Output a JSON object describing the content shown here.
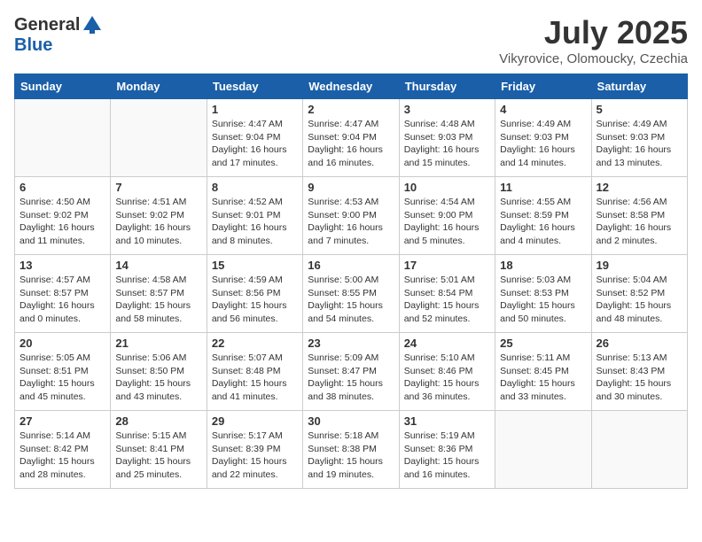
{
  "header": {
    "logo_general": "General",
    "logo_blue": "Blue",
    "month_title": "July 2025",
    "subtitle": "Vikyrovice, Olomoucky, Czechia"
  },
  "days_of_week": [
    "Sunday",
    "Monday",
    "Tuesday",
    "Wednesday",
    "Thursday",
    "Friday",
    "Saturday"
  ],
  "weeks": [
    [
      {
        "day": "",
        "content": ""
      },
      {
        "day": "",
        "content": ""
      },
      {
        "day": "1",
        "content": "Sunrise: 4:47 AM\nSunset: 9:04 PM\nDaylight: 16 hours\nand 17 minutes."
      },
      {
        "day": "2",
        "content": "Sunrise: 4:47 AM\nSunset: 9:04 PM\nDaylight: 16 hours\nand 16 minutes."
      },
      {
        "day": "3",
        "content": "Sunrise: 4:48 AM\nSunset: 9:03 PM\nDaylight: 16 hours\nand 15 minutes."
      },
      {
        "day": "4",
        "content": "Sunrise: 4:49 AM\nSunset: 9:03 PM\nDaylight: 16 hours\nand 14 minutes."
      },
      {
        "day": "5",
        "content": "Sunrise: 4:49 AM\nSunset: 9:03 PM\nDaylight: 16 hours\nand 13 minutes."
      }
    ],
    [
      {
        "day": "6",
        "content": "Sunrise: 4:50 AM\nSunset: 9:02 PM\nDaylight: 16 hours\nand 11 minutes."
      },
      {
        "day": "7",
        "content": "Sunrise: 4:51 AM\nSunset: 9:02 PM\nDaylight: 16 hours\nand 10 minutes."
      },
      {
        "day": "8",
        "content": "Sunrise: 4:52 AM\nSunset: 9:01 PM\nDaylight: 16 hours\nand 8 minutes."
      },
      {
        "day": "9",
        "content": "Sunrise: 4:53 AM\nSunset: 9:00 PM\nDaylight: 16 hours\nand 7 minutes."
      },
      {
        "day": "10",
        "content": "Sunrise: 4:54 AM\nSunset: 9:00 PM\nDaylight: 16 hours\nand 5 minutes."
      },
      {
        "day": "11",
        "content": "Sunrise: 4:55 AM\nSunset: 8:59 PM\nDaylight: 16 hours\nand 4 minutes."
      },
      {
        "day": "12",
        "content": "Sunrise: 4:56 AM\nSunset: 8:58 PM\nDaylight: 16 hours\nand 2 minutes."
      }
    ],
    [
      {
        "day": "13",
        "content": "Sunrise: 4:57 AM\nSunset: 8:57 PM\nDaylight: 16 hours\nand 0 minutes."
      },
      {
        "day": "14",
        "content": "Sunrise: 4:58 AM\nSunset: 8:57 PM\nDaylight: 15 hours\nand 58 minutes."
      },
      {
        "day": "15",
        "content": "Sunrise: 4:59 AM\nSunset: 8:56 PM\nDaylight: 15 hours\nand 56 minutes."
      },
      {
        "day": "16",
        "content": "Sunrise: 5:00 AM\nSunset: 8:55 PM\nDaylight: 15 hours\nand 54 minutes."
      },
      {
        "day": "17",
        "content": "Sunrise: 5:01 AM\nSunset: 8:54 PM\nDaylight: 15 hours\nand 52 minutes."
      },
      {
        "day": "18",
        "content": "Sunrise: 5:03 AM\nSunset: 8:53 PM\nDaylight: 15 hours\nand 50 minutes."
      },
      {
        "day": "19",
        "content": "Sunrise: 5:04 AM\nSunset: 8:52 PM\nDaylight: 15 hours\nand 48 minutes."
      }
    ],
    [
      {
        "day": "20",
        "content": "Sunrise: 5:05 AM\nSunset: 8:51 PM\nDaylight: 15 hours\nand 45 minutes."
      },
      {
        "day": "21",
        "content": "Sunrise: 5:06 AM\nSunset: 8:50 PM\nDaylight: 15 hours\nand 43 minutes."
      },
      {
        "day": "22",
        "content": "Sunrise: 5:07 AM\nSunset: 8:48 PM\nDaylight: 15 hours\nand 41 minutes."
      },
      {
        "day": "23",
        "content": "Sunrise: 5:09 AM\nSunset: 8:47 PM\nDaylight: 15 hours\nand 38 minutes."
      },
      {
        "day": "24",
        "content": "Sunrise: 5:10 AM\nSunset: 8:46 PM\nDaylight: 15 hours\nand 36 minutes."
      },
      {
        "day": "25",
        "content": "Sunrise: 5:11 AM\nSunset: 8:45 PM\nDaylight: 15 hours\nand 33 minutes."
      },
      {
        "day": "26",
        "content": "Sunrise: 5:13 AM\nSunset: 8:43 PM\nDaylight: 15 hours\nand 30 minutes."
      }
    ],
    [
      {
        "day": "27",
        "content": "Sunrise: 5:14 AM\nSunset: 8:42 PM\nDaylight: 15 hours\nand 28 minutes."
      },
      {
        "day": "28",
        "content": "Sunrise: 5:15 AM\nSunset: 8:41 PM\nDaylight: 15 hours\nand 25 minutes."
      },
      {
        "day": "29",
        "content": "Sunrise: 5:17 AM\nSunset: 8:39 PM\nDaylight: 15 hours\nand 22 minutes."
      },
      {
        "day": "30",
        "content": "Sunrise: 5:18 AM\nSunset: 8:38 PM\nDaylight: 15 hours\nand 19 minutes."
      },
      {
        "day": "31",
        "content": "Sunrise: 5:19 AM\nSunset: 8:36 PM\nDaylight: 15 hours\nand 16 minutes."
      },
      {
        "day": "",
        "content": ""
      },
      {
        "day": "",
        "content": ""
      }
    ]
  ]
}
